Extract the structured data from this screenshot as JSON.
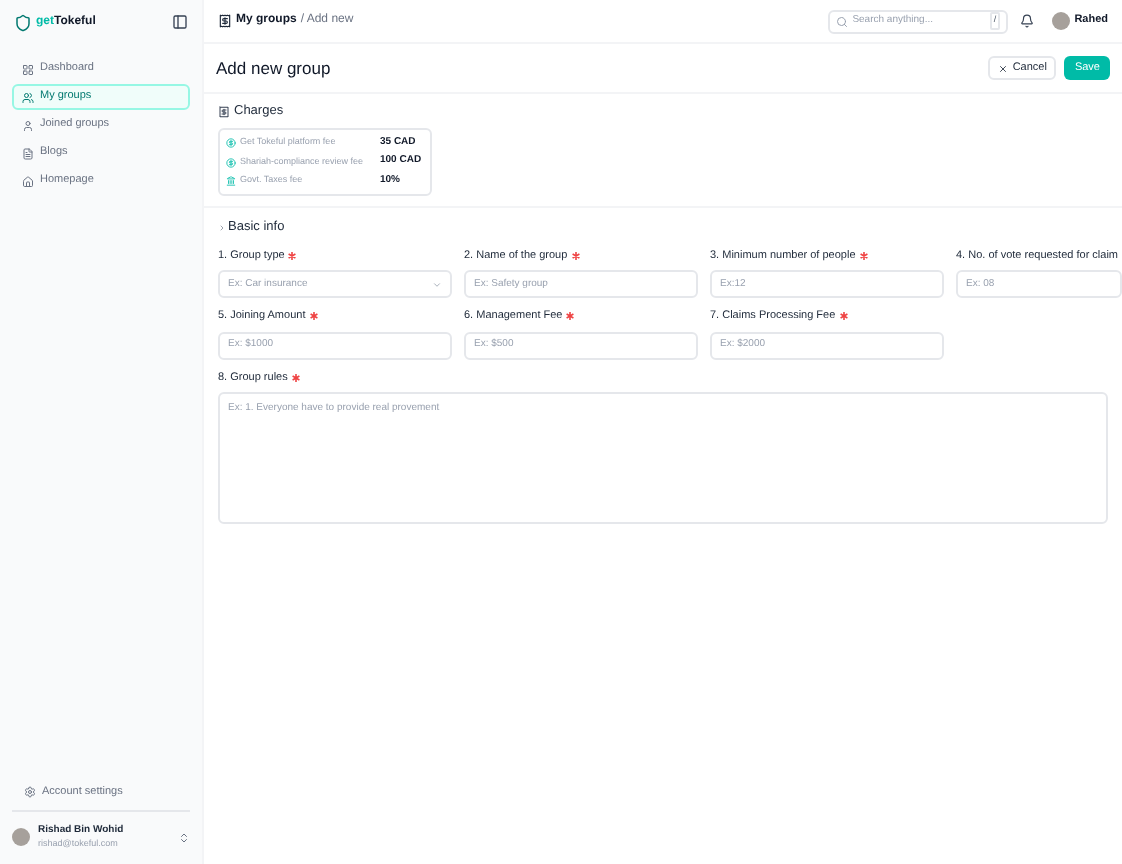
{
  "brand": {
    "prefix": "get",
    "name": "Tokeful"
  },
  "sidebar": {
    "items": [
      {
        "label": "Dashboard",
        "kind": "grid",
        "selected": false
      },
      {
        "label": "My groups",
        "kind": "groups",
        "selected": true
      },
      {
        "label": "Joined groups",
        "kind": "user",
        "selected": false
      },
      {
        "label": "Blogs",
        "kind": "doc",
        "selected": false
      },
      {
        "label": "Homepage",
        "kind": "home",
        "selected": false
      }
    ],
    "footer": {
      "settings": "Account settings",
      "user_name": "Rishad Bin Wohid",
      "user_email": "rishad@tokeful.com"
    }
  },
  "header": {
    "breadcrumb": [
      "My groups",
      "/ Add new"
    ],
    "search_placeholder": "Search anything...",
    "shortcut": "/",
    "user_name": "Rahed"
  },
  "page": {
    "title": "Add new group",
    "cancel": "Cancel",
    "save": "Save"
  },
  "charges": {
    "title": "Charges",
    "rows": [
      {
        "label": "Get Tokeful platform fee",
        "value": "35 CAD"
      },
      {
        "label": "Shariah-compliance review fee",
        "value": "100 CAD"
      },
      {
        "label": "Govt. Taxes fee",
        "value": "10%"
      }
    ]
  },
  "basic_info": {
    "title": "Basic info",
    "fields": [
      {
        "label": "1. Group type",
        "placeholder": "Ex: Car insurance",
        "kind": "select",
        "required": true
      },
      {
        "label": "2. Name of the group",
        "placeholder": "Ex: Safety group",
        "kind": "text",
        "required": true
      },
      {
        "label": "3. Minimum number of people",
        "placeholder": "Ex:12",
        "kind": "text",
        "required": true
      },
      {
        "label": "4. No. of vote requested for claim",
        "placeholder": "Ex: 08",
        "kind": "text"
      },
      {
        "label": "5. Joining Amount",
        "placeholder": "Ex: $1000",
        "kind": "text",
        "required": true
      },
      {
        "label": "6. Management Fee",
        "placeholder": "Ex: $500",
        "kind": "text",
        "required": true
      },
      {
        "label": "7. Claims Processing Fee",
        "placeholder": "Ex: $2000",
        "kind": "text",
        "required": true
      }
    ],
    "rules": {
      "label": "8. Group rules",
      "placeholder": "Ex: 1. Everyone have to provide real provement",
      "required": true
    }
  }
}
